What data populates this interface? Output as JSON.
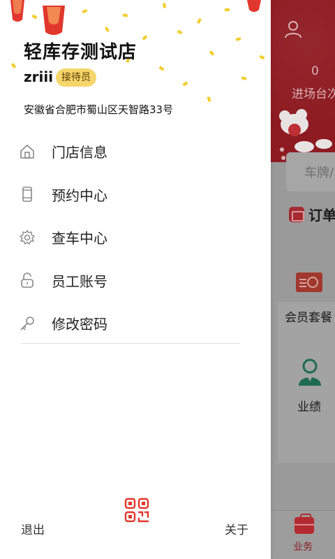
{
  "drawer": {
    "store_name": "轻库存测试店",
    "user_name": "zriii",
    "role_badge": "接待员",
    "address": "安徽省合肥市蜀山区天智路33号",
    "menu": [
      {
        "label": "门店信息",
        "icon": "store-home-icon"
      },
      {
        "label": "预约中心",
        "icon": "phone-icon"
      },
      {
        "label": "查车中心",
        "icon": "gear-icon"
      },
      {
        "label": "员工账号",
        "icon": "unlock-icon"
      },
      {
        "label": "修改密码",
        "icon": "key-icon"
      }
    ],
    "footer": {
      "logout_label": "退出",
      "about_label": "关于",
      "qr_icon": "qr-code-icon"
    }
  },
  "background": {
    "count_value": "0",
    "count_label": "进场台次",
    "plate_placeholder": "车牌/",
    "order_label": "订单",
    "member_label": "会员套餐",
    "performance_label": "业绩",
    "tab_label": "业务"
  },
  "colors": {
    "brand_red": "#b52a31",
    "badge_yellow": "#f6d66b",
    "confetti": "#f2cd2d"
  }
}
